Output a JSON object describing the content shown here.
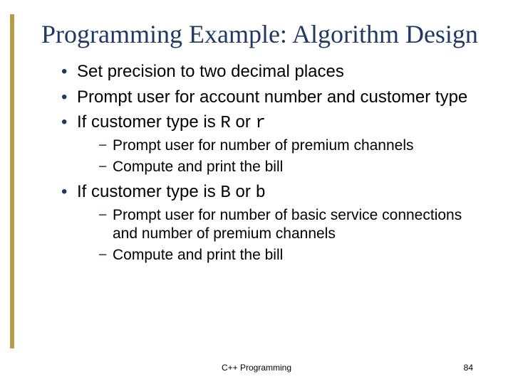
{
  "title": "Programming Example: Algorithm Design",
  "bullets": {
    "b0": "Set precision to two decimal places",
    "b1": "Prompt user for account number and customer type",
    "b2": {
      "pre": "If customer type is ",
      "code1": "R",
      "mid": " or ",
      "code2": "r"
    },
    "b2sub": [
      "Prompt user for number of premium channels",
      "Compute and print the bill"
    ],
    "b3": {
      "pre": "If customer type is ",
      "code1": "B",
      "mid": " or ",
      "code2": "b"
    },
    "b3sub": [
      "Prompt user for number of basic service connections and number of premium channels",
      "Compute and print the bill"
    ]
  },
  "footer": "C++ Programming",
  "page_number": "84"
}
